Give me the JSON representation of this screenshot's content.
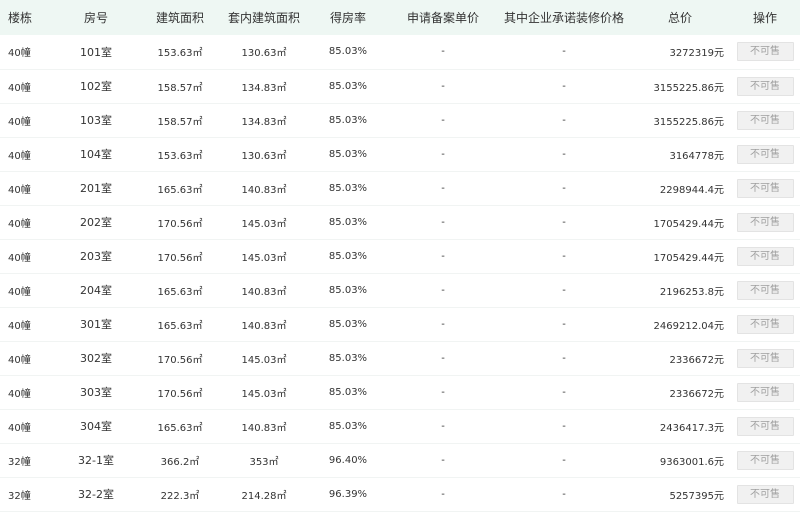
{
  "table": {
    "headers": [
      "楼栋",
      "房号",
      "建筑面积",
      "套内建筑面积",
      "得房率",
      "申请备案单价",
      "其中企业承诺装修价格",
      "总价",
      "操作"
    ],
    "rows": [
      {
        "building": "40幢",
        "room": "101室",
        "area": "153.63㎡",
        "inner_area": "130.63㎡",
        "rate": "85.03%",
        "unit_price": "-",
        "decoration_price": "-",
        "total": "3272319元",
        "action": "不可售"
      },
      {
        "building": "40幢",
        "room": "102室",
        "area": "158.57㎡",
        "inner_area": "134.83㎡",
        "rate": "85.03%",
        "unit_price": "-",
        "decoration_price": "-",
        "total": "3155225.86元",
        "action": "不可售"
      },
      {
        "building": "40幢",
        "room": "103室",
        "area": "158.57㎡",
        "inner_area": "134.83㎡",
        "rate": "85.03%",
        "unit_price": "-",
        "decoration_price": "-",
        "total": "3155225.86元",
        "action": "不可售"
      },
      {
        "building": "40幢",
        "room": "104室",
        "area": "153.63㎡",
        "inner_area": "130.63㎡",
        "rate": "85.03%",
        "unit_price": "-",
        "decoration_price": "-",
        "total": "3164778元",
        "action": "不可售"
      },
      {
        "building": "40幢",
        "room": "201室",
        "area": "165.63㎡",
        "inner_area": "140.83㎡",
        "rate": "85.03%",
        "unit_price": "-",
        "decoration_price": "-",
        "total": "2298944.4元",
        "action": "不可售"
      },
      {
        "building": "40幢",
        "room": "202室",
        "area": "170.56㎡",
        "inner_area": "145.03㎡",
        "rate": "85.03%",
        "unit_price": "-",
        "decoration_price": "-",
        "total": "1705429.44元",
        "action": "不可售"
      },
      {
        "building": "40幢",
        "room": "203室",
        "area": "170.56㎡",
        "inner_area": "145.03㎡",
        "rate": "85.03%",
        "unit_price": "-",
        "decoration_price": "-",
        "total": "1705429.44元",
        "action": "不可售"
      },
      {
        "building": "40幢",
        "room": "204室",
        "area": "165.63㎡",
        "inner_area": "140.83㎡",
        "rate": "85.03%",
        "unit_price": "-",
        "decoration_price": "-",
        "total": "2196253.8元",
        "action": "不可售"
      },
      {
        "building": "40幢",
        "room": "301室",
        "area": "165.63㎡",
        "inner_area": "140.83㎡",
        "rate": "85.03%",
        "unit_price": "-",
        "decoration_price": "-",
        "total": "2469212.04元",
        "action": "不可售"
      },
      {
        "building": "40幢",
        "room": "302室",
        "area": "170.56㎡",
        "inner_area": "145.03㎡",
        "rate": "85.03%",
        "unit_price": "-",
        "decoration_price": "-",
        "total": "2336672元",
        "action": "不可售"
      },
      {
        "building": "40幢",
        "room": "303室",
        "area": "170.56㎡",
        "inner_area": "145.03㎡",
        "rate": "85.03%",
        "unit_price": "-",
        "decoration_price": "-",
        "total": "2336672元",
        "action": "不可售"
      },
      {
        "building": "40幢",
        "room": "304室",
        "area": "165.63㎡",
        "inner_area": "140.83㎡",
        "rate": "85.03%",
        "unit_price": "-",
        "decoration_price": "-",
        "total": "2436417.3元",
        "action": "不可售"
      },
      {
        "building": "32幢",
        "room": "32-1室",
        "area": "366.2㎡",
        "inner_area": "353㎡",
        "rate": "96.40%",
        "unit_price": "-",
        "decoration_price": "-",
        "total": "9363001.6元",
        "action": "不可售"
      },
      {
        "building": "32幢",
        "room": "32-2室",
        "area": "222.3㎡",
        "inner_area": "214.28㎡",
        "rate": "96.39%",
        "unit_price": "-",
        "decoration_price": "-",
        "total": "5257395元",
        "action": "不可售"
      }
    ]
  }
}
